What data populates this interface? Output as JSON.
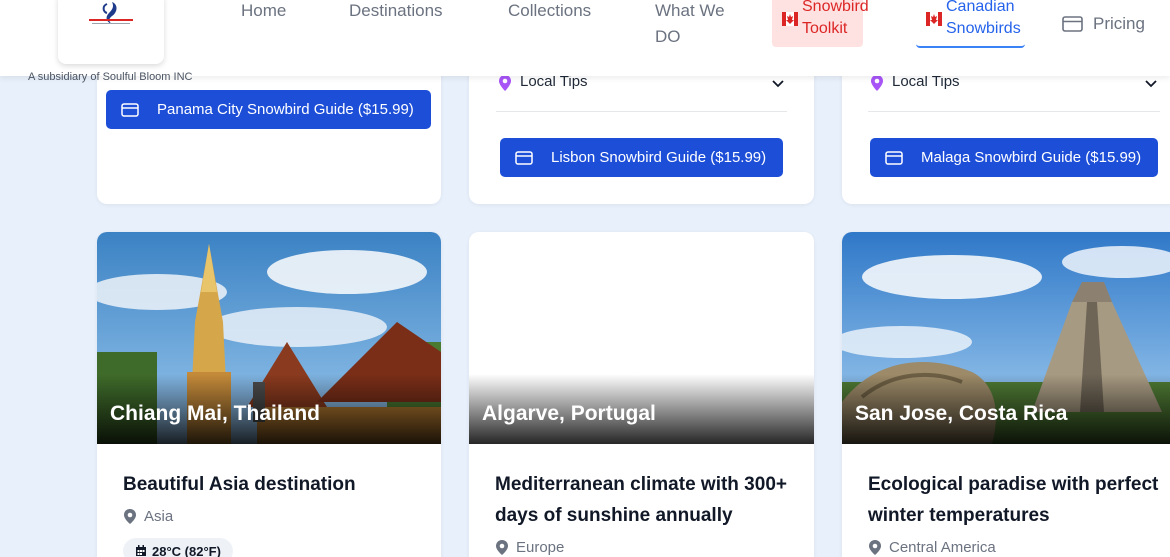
{
  "header": {
    "tagline": "A subsidiary of Soulful Bloom INC",
    "nav": {
      "home": "Home",
      "destinations": "Destinations",
      "collections": "Collections",
      "what_we_do": "What We DO",
      "snowbird_toolkit": "Snowbird Toolkit",
      "canadian_snowbirds": "Canadian Snowbirds",
      "pricing": "Pricing"
    }
  },
  "top_cards": [
    {
      "guide_button": "Panama City Snowbird Guide ($15.99)"
    },
    {
      "tips_label": "Local Tips",
      "guide_button": "Lisbon Snowbird Guide ($15.99)"
    },
    {
      "tips_label": "Local Tips",
      "guide_button": "Malaga Snowbird Guide ($15.99)"
    }
  ],
  "destinations": [
    {
      "name": "Chiang Mai, Thailand",
      "description": "Beautiful Asia destination",
      "region": "Asia",
      "temperature": "28°C (82°F)"
    },
    {
      "name": "Algarve, Portugal",
      "description": "Mediterranean climate with 300+ days of sunshine annually",
      "region": "Europe"
    },
    {
      "name": "San Jose, Costa Rica",
      "description": "Ecological paradise with perfect winter temperatures",
      "region": "Central America"
    }
  ],
  "colors": {
    "primary_button": "#1d4ed8",
    "accent_red": "#dc2626",
    "accent_blue": "#2563eb",
    "pin_purple": "#a855f7"
  },
  "icons": {
    "pricing": "credit-card-icon",
    "guide_button": "credit-card-icon",
    "tips": "map-pin-icon",
    "tips_toggle": "chevron-down-icon",
    "region": "map-pin-icon",
    "temperature": "calendar-icon",
    "toolkit": "canada-flag-icon"
  }
}
